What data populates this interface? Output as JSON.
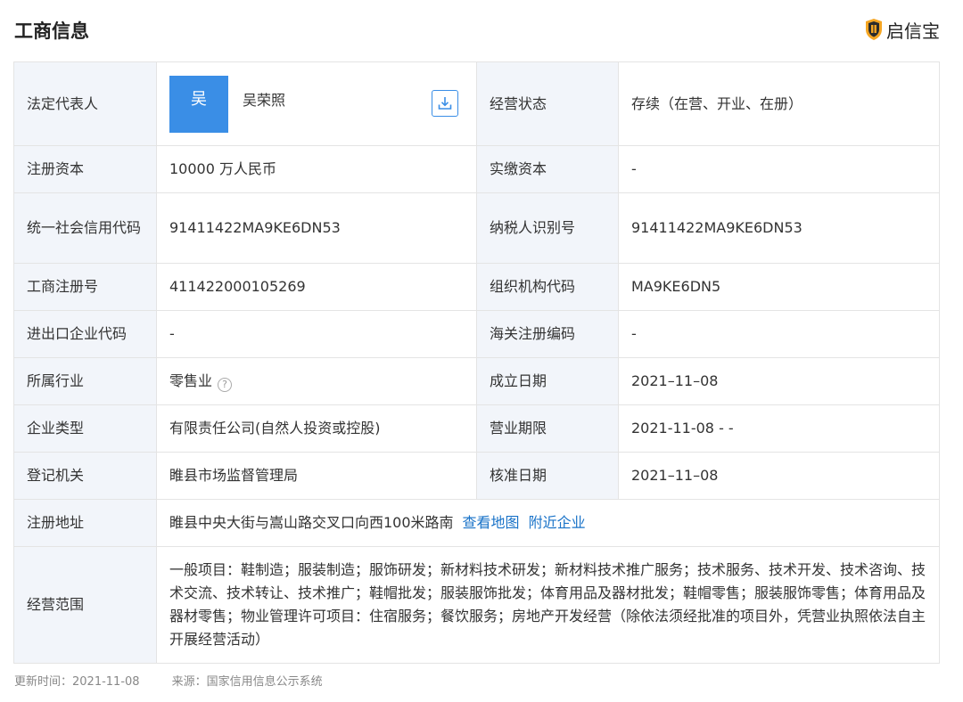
{
  "header": {
    "title": "工商信息",
    "brand_name": "启信宝",
    "brand_icon": "shield-logo-icon",
    "brand_color": "#f5a623"
  },
  "legal_rep": {
    "label": "法定代表人",
    "avatar_char": "吴",
    "name": "吴荣照",
    "avatar_color": "#3a8ee6",
    "download_icon": "download-icon"
  },
  "rows": {
    "status": {
      "label": "经营状态",
      "value": "存续（在营、开业、在册）"
    },
    "reg_capital": {
      "label": "注册资本",
      "value": "10000 万人民币"
    },
    "paid_capital": {
      "label": "实缴资本",
      "value": "-"
    },
    "credit_code": {
      "label": "统一社会信用代码",
      "value": "91411422MA9KE6DN53"
    },
    "taxpayer_id": {
      "label": "纳税人识别号",
      "value": "91411422MA9KE6DN53"
    },
    "reg_number": {
      "label": "工商注册号",
      "value": "411422000105269"
    },
    "org_code": {
      "label": "组织机构代码",
      "value": "MA9KE6DN5"
    },
    "import_export_code": {
      "label": "进出口企业代码",
      "value": "-"
    },
    "customs_code": {
      "label": "海关注册编码",
      "value": "-"
    },
    "industry": {
      "label": "所属行业",
      "value": "零售业",
      "help_icon": "question-circle-icon"
    },
    "found_date": {
      "label": "成立日期",
      "value": "2021–11–08"
    },
    "company_type": {
      "label": "企业类型",
      "value": "有限责任公司(自然人投资或控股)"
    },
    "business_term": {
      "label": "营业期限",
      "value": "2021-11-08 - -"
    },
    "reg_authority": {
      "label": "登记机关",
      "value": "睢县市场监督管理局"
    },
    "approval_date": {
      "label": "核准日期",
      "value": "2021–11–08"
    },
    "address": {
      "label": "注册地址",
      "value": "睢县中央大街与嵩山路交叉口向西100米路南",
      "map_link": "查看地图",
      "nearby_link": "附近企业",
      "link_color": "#1a73c8"
    },
    "scope": {
      "label": "经营范围",
      "value": "一般项目：鞋制造；服装制造；服饰研发；新材料技术研发；新材料技术推广服务；技术服务、技术开发、技术咨询、技术交流、技术转让、技术推广；鞋帽批发；服装服饰批发；体育用品及器材批发；鞋帽零售；服装服饰零售；体育用品及器材零售；物业管理许可项目：住宿服务；餐饮服务；房地产开发经营（除依法须经批准的项目外，凭营业执照依法自主开展经营活动）"
    }
  },
  "footer": {
    "updated": "更新时间：2021-11-08",
    "source": "来源：国家信用信息公示系统"
  },
  "colors": {
    "label_bg": "#f2f5fa",
    "border": "#e4e4e4"
  }
}
